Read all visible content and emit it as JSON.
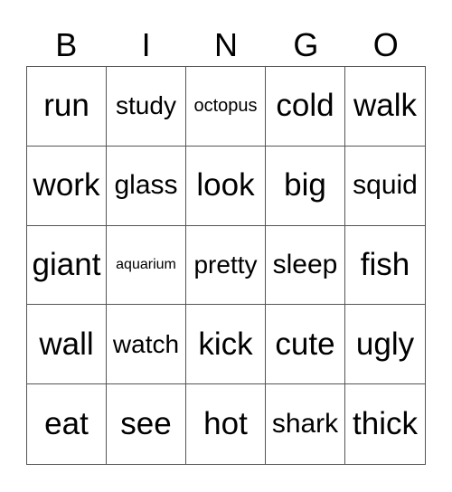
{
  "header": [
    "B",
    "I",
    "N",
    "G",
    "O"
  ],
  "cells": [
    "run",
    "study",
    "octopus",
    "cold",
    "walk",
    "work",
    "glass",
    "look",
    "big",
    "squid",
    "giant",
    "aquarium",
    "pretty",
    "sleep",
    "fish",
    "wall",
    "watch",
    "kick",
    "cute",
    "ugly",
    "eat",
    "see",
    "hot",
    "shark",
    "thick"
  ]
}
